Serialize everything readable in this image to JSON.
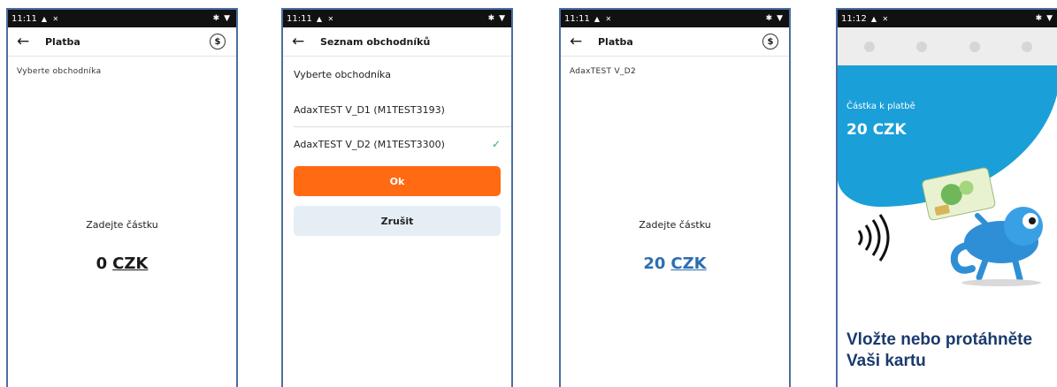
{
  "status_times": {
    "s1": "11:11",
    "s2": "11:11",
    "s3": "11:11",
    "s4": "11:12"
  },
  "screen1": {
    "title": "Platba",
    "merchant_label": "Vyberte obchodníka",
    "enter_amount": "Zadejte částku",
    "amount_value": "0",
    "currency": "CZK"
  },
  "screen2": {
    "title": "Seznam obchodníků",
    "header": "Vyberte obchodníka",
    "merchants": [
      {
        "label": "AdaxTEST V_D1 (M1TEST3193)",
        "selected": false
      },
      {
        "label": "AdaxTEST V_D2 (M1TEST3300)",
        "selected": true
      }
    ],
    "ok_label": "Ok",
    "cancel_label": "Zrušit"
  },
  "screen3": {
    "title": "Platba",
    "merchant_label": "AdaxTEST V_D2",
    "enter_amount": "Zadejte částku",
    "amount_value": "20",
    "currency": "CZK"
  },
  "screen4": {
    "amount_label": "Částka k platbě",
    "amount": "20 CZK",
    "instruction": "Vložte nebo protáhněte Vaši kartu"
  },
  "colors": {
    "accent_orange": "#ff6a13",
    "brand_blue": "#1b9fd8",
    "amount_blue": "#2c6fb0",
    "text_navy": "#1a3a6e"
  }
}
